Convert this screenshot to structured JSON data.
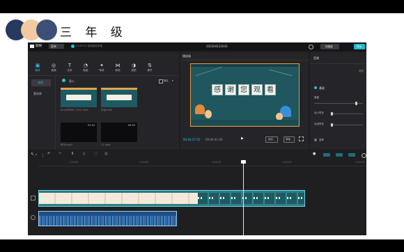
{
  "slide": {
    "title": "三 年 级",
    "circle_colors": [
      "#263a60",
      "#f2c9a0",
      "#3b4f78"
    ]
  },
  "app": {
    "logo": "剪映",
    "menu_label": "菜单",
    "autosave_text": "22:05:42 自动保存本地",
    "project_name": "202204121643",
    "shortcut_label": "快捷键",
    "export_label": "导出",
    "tools": [
      {
        "icon": "media-icon",
        "glyph": "▣",
        "label": "媒体",
        "active": true
      },
      {
        "icon": "audio-icon",
        "glyph": "◎",
        "label": "音频",
        "active": false
      },
      {
        "icon": "text-icon",
        "glyph": "T",
        "label": "文本",
        "active": false
      },
      {
        "icon": "sticker-icon",
        "glyph": "◔",
        "label": "贴纸",
        "active": false
      },
      {
        "icon": "effects-icon",
        "glyph": "✦",
        "label": "特效",
        "active": false
      },
      {
        "icon": "transition-icon",
        "glyph": "⋈",
        "label": "转场",
        "active": false
      },
      {
        "icon": "filter-icon",
        "glyph": "◑",
        "label": "滤镜",
        "active": false
      },
      {
        "icon": "adjust-icon",
        "glyph": "⇅",
        "label": "调节",
        "active": false
      }
    ],
    "sidebar": {
      "local": "本地",
      "library": "素材库"
    },
    "media": {
      "import_label": "导入",
      "sort_label": "默认",
      "items": [
        {
          "name": "Snvd3E6W...1201.mp4",
          "duration": "",
          "kind": "green"
        },
        {
          "name": "好运.mp4",
          "duration": "",
          "kind": "green"
        },
        {
          "name": "BEJ0.mp4",
          "duration": "01:10",
          "kind": "dark"
        },
        {
          "name": "11.mp4",
          "duration": "00:53",
          "kind": "dark"
        }
      ]
    },
    "player": {
      "title": "播放器",
      "banner_chars": [
        "感",
        "谢",
        "您",
        "观",
        "看"
      ],
      "current_time": "00:04:37:03",
      "total_time": "00:04:41:09",
      "ratio_label": "适应",
      "original_label": "原始"
    },
    "properties": {
      "tab": "音频",
      "basic_label": "基础",
      "volume_label": "音量",
      "fade_in_label": "淡入时长",
      "fade_out_label": "淡出时长",
      "voice_change_label": "变声",
      "volume_level": 0.85,
      "fade_in_level": 0.05,
      "fade_out_level": 0.05
    },
    "timeline": {
      "ticks": [
        "1:04:35",
        "1:04:30",
        "1:04:25",
        "1:04:20",
        "1:04:15"
      ]
    }
  }
}
